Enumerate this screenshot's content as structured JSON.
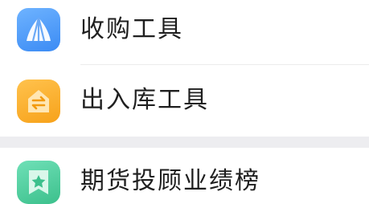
{
  "menu": {
    "items": [
      {
        "label": "收购工具",
        "icon": "shell-icon",
        "color": "#3b8bf4"
      },
      {
        "label": "出入库工具",
        "icon": "transfer-arrows-icon",
        "color": "#f7a21a"
      },
      {
        "label": "期货投顾业绩榜",
        "icon": "star-bookmark-icon",
        "color": "#3cc08c"
      }
    ]
  }
}
